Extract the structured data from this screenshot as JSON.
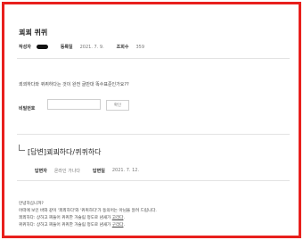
{
  "post": {
    "title": "쾨쾨 퀴퀴",
    "author_label": "작성자",
    "date_label": "등록일",
    "date_value": "2021. 7. 9.",
    "views_label": "조회수",
    "views_value": "359",
    "question": "쾨쾨하다와 퀴퀴하다는 것이 완전 글만대 똑수표준인가요??",
    "password_label": "비밀번호",
    "password_value": "",
    "confirm_button": "확인"
  },
  "reply": {
    "title": "[답변]쾨쾨하다/퀴퀴하다",
    "author_label": "답변자",
    "author_value": "온라인 가나다",
    "date_label": "답변일",
    "date_value": "2021. 7. 12.",
    "lines": [
      "안녕하십니까?",
      "어떠에 보인 바와 같이 '쾨쾨하다'와 '퀴퀴하다'가 동의어는 아님을 알려 드립니다.",
      "쾨쾨하다: 상하고 찌들어 퀴퀴한 거슬림 정도로 냄새가 ",
      "퀴퀴하다: 상하고 찌들어 퀴퀴한 거슬림 정도로 냄새가 "
    ],
    "link1": "고리다",
    "link2": "구리다"
  },
  "colors": {
    "frame_border": "#e8201d"
  }
}
